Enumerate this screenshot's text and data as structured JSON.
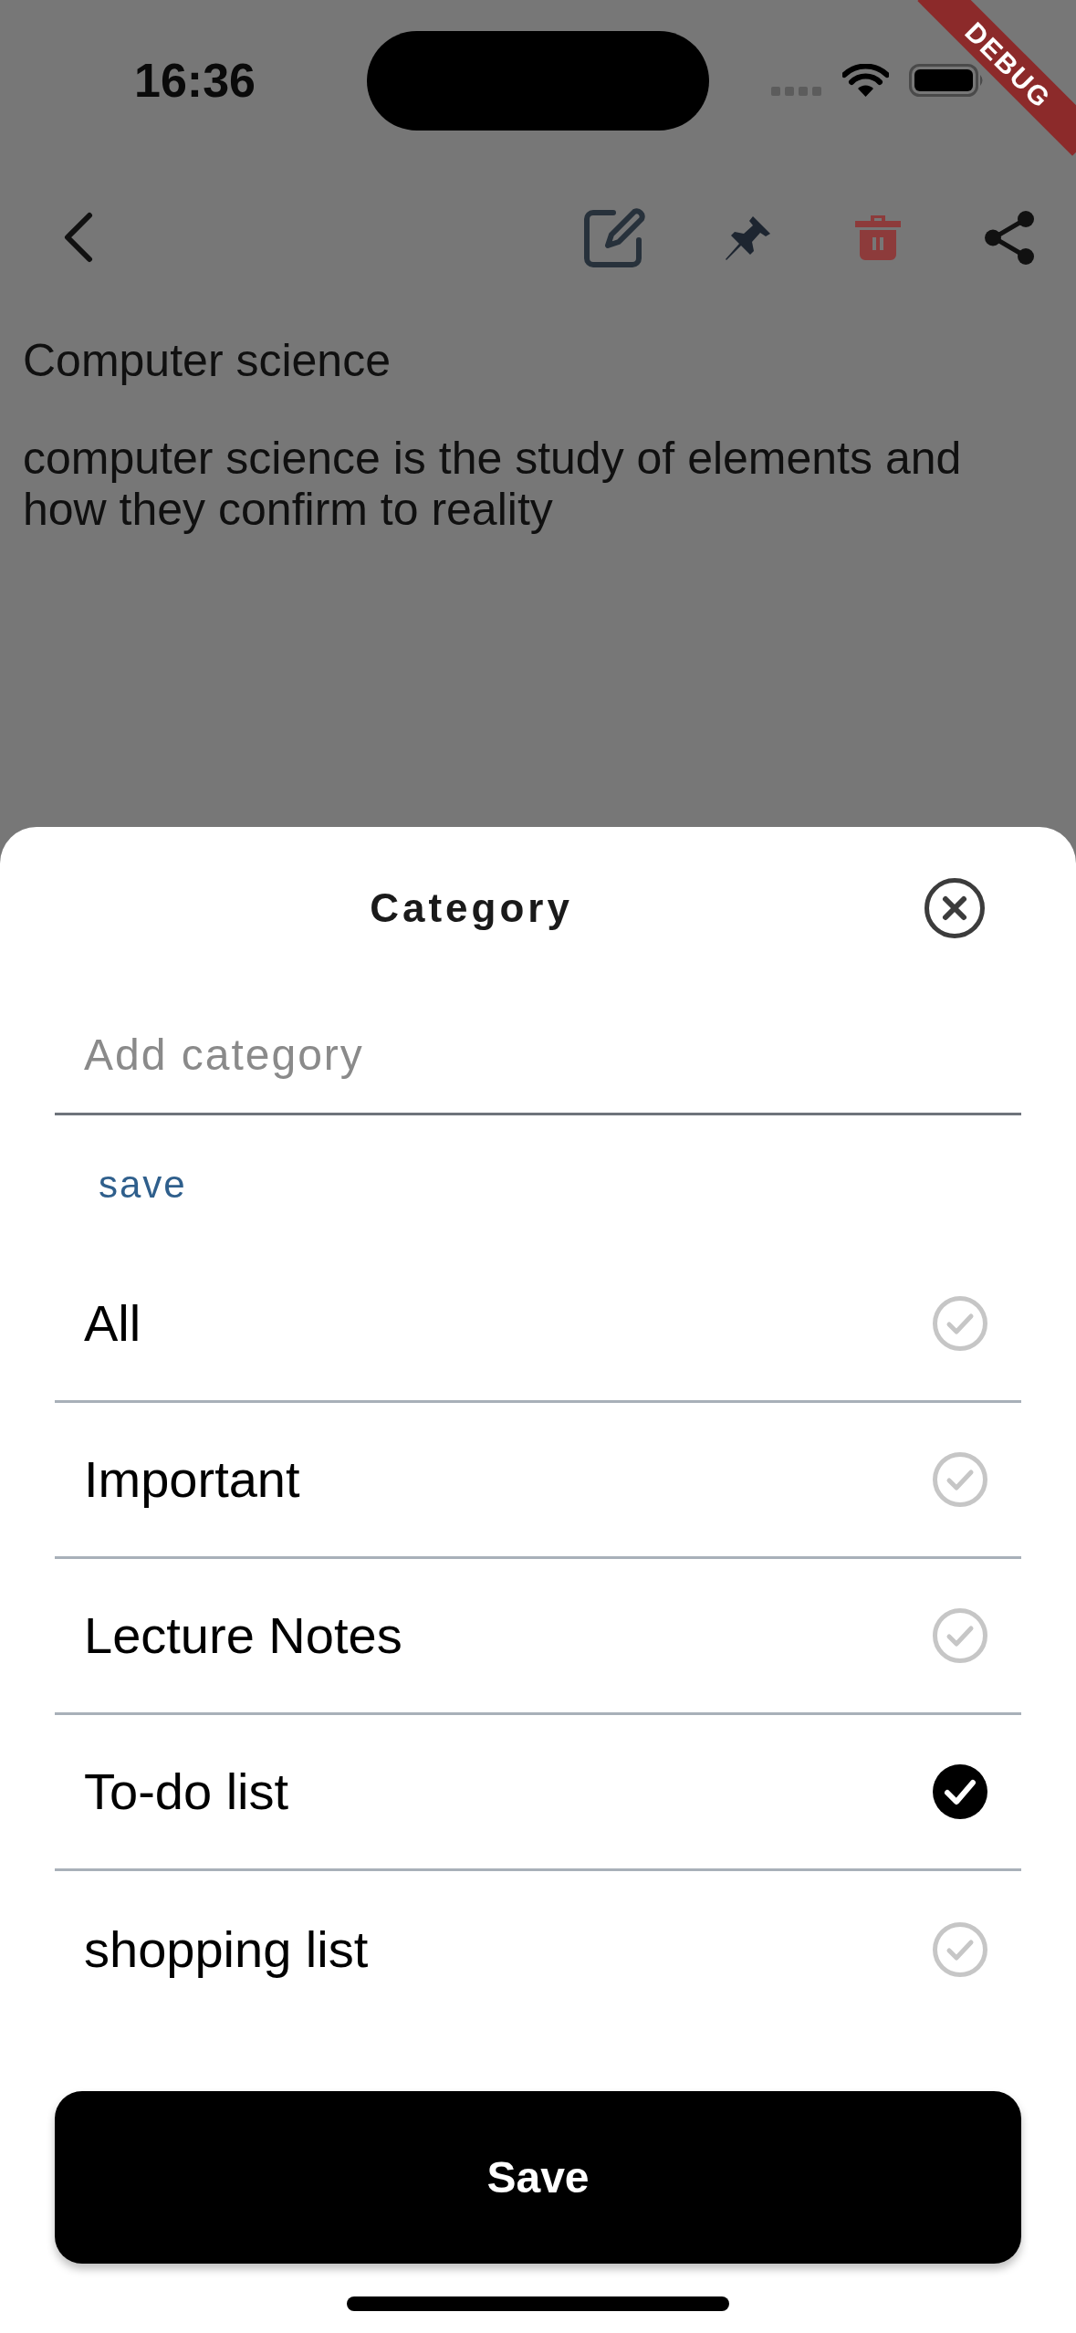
{
  "status_bar": {
    "time": "16:36"
  },
  "debug_banner": {
    "label": "DEBUG"
  },
  "note": {
    "title": "Computer science",
    "body": "computer science is the study of elements and how they confirm to reality"
  },
  "category_sheet": {
    "title": "Category",
    "input": {
      "placeholder": "Add category"
    },
    "save_link": "save",
    "categories": [
      {
        "label": "All",
        "selected": false
      },
      {
        "label": "Important",
        "selected": false
      },
      {
        "label": "Lecture Notes",
        "selected": false
      },
      {
        "label": "To-do list",
        "selected": true
      },
      {
        "label": "shopping list",
        "selected": false
      }
    ],
    "save_button": "Save"
  }
}
